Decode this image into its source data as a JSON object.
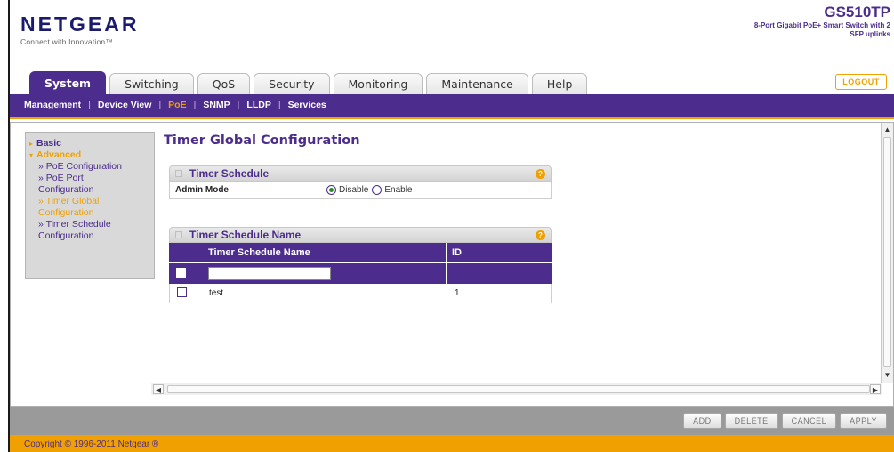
{
  "brand": {
    "name": "NETGEAR",
    "tagline": "Connect with Innovation™",
    "model": "GS510TP",
    "description": "8-Port Gigabit PoE+ Smart Switch with 2 SFP uplinks"
  },
  "tabs": [
    {
      "label": "System",
      "active": true
    },
    {
      "label": "Switching",
      "active": false
    },
    {
      "label": "QoS",
      "active": false
    },
    {
      "label": "Security",
      "active": false
    },
    {
      "label": "Monitoring",
      "active": false
    },
    {
      "label": "Maintenance",
      "active": false
    },
    {
      "label": "Help",
      "active": false
    }
  ],
  "logout_label": "LOGOUT",
  "subnav": [
    {
      "label": "Management"
    },
    {
      "label": "Device View"
    },
    {
      "label": "PoE"
    },
    {
      "label": "SNMP"
    },
    {
      "label": "LLDP"
    },
    {
      "label": "Services"
    }
  ],
  "sidebar": {
    "basic": "Basic",
    "advanced": "Advanced",
    "items": [
      {
        "label": "PoE Configuration"
      },
      {
        "label": "PoE Port Configuration"
      },
      {
        "label": "Timer Global Configuration"
      },
      {
        "label": "Timer Schedule Configuration"
      }
    ]
  },
  "main": {
    "title": "Timer Global Configuration",
    "timer_schedule": {
      "header": "Timer Schedule",
      "admin_mode_label": "Admin Mode",
      "option_disable": "Disable",
      "option_enable": "Enable",
      "selected": "Disable"
    },
    "schedule_name": {
      "header": "Timer Schedule Name",
      "columns": [
        "Timer Schedule Name",
        "ID"
      ],
      "input_value": "",
      "rows": [
        {
          "name": "test",
          "id": "1"
        }
      ]
    }
  },
  "buttons": {
    "add": "ADD",
    "delete": "DELETE",
    "cancel": "CANCEL",
    "apply": "APPLY"
  },
  "footer": {
    "copyright": "Copyright © 1996-2011 Netgear ®"
  },
  "colors": {
    "brand_purple": "#4c2c8c",
    "accent_orange": "#f0a000"
  }
}
